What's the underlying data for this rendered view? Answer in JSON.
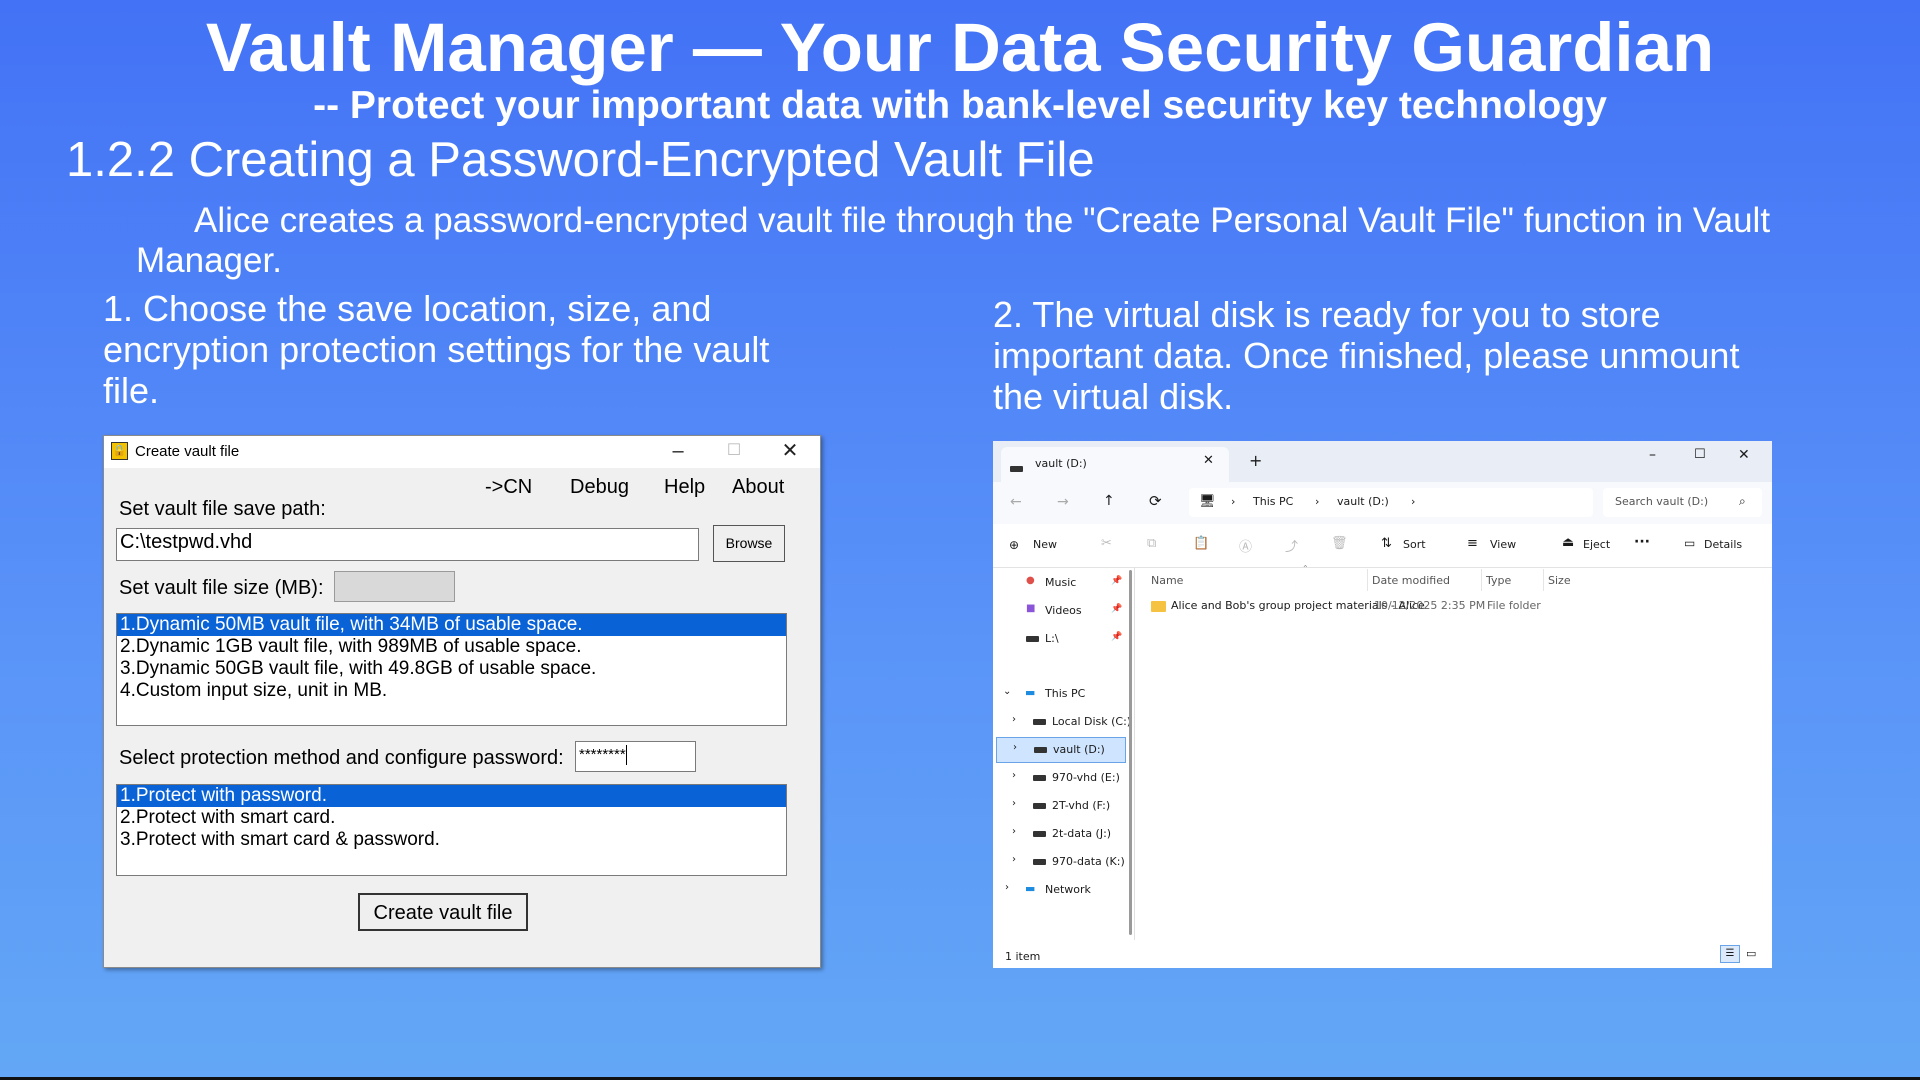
{
  "slide": {
    "title": "Vault Manager —  Your Data Security Guardian",
    "subtitle": "-- Protect your important data with bank-level security key technology",
    "section": "1.2.2 Creating a Password-Encrypted Vault File",
    "intro": "Alice creates a password-encrypted vault file through the \"Create Personal Vault File\" function in Vault Manager.",
    "step1": "1. Choose the save location, size, and encryption protection settings for the vault file.",
    "step2": "2. The virtual disk is ready for you to store important data. Once finished, please unmount the virtual disk."
  },
  "dialog": {
    "title": "Create vault file",
    "menu": [
      "->CN",
      "Debug",
      "Help",
      "About"
    ],
    "save_path_label": "Set vault file save path:",
    "save_path_value": "C:\\testpwd.vhd",
    "browse_label": "Browse",
    "size_label": "Set vault file size (MB):",
    "size_options": [
      "1.Dynamic 50MB vault file, with 34MB of usable space.",
      "2.Dynamic 1GB vault file, with 989MB of usable space.",
      "3.Dynamic 50GB vault file, with 49.8GB of usable space.",
      "4.Custom input size, unit in MB."
    ],
    "protection_label": "Select protection method and configure password:",
    "password_value": "********",
    "protection_options": [
      "1.Protect with password.",
      "2.Protect with smart card.",
      "3.Protect with smart card & password."
    ],
    "create_label": "Create vault file"
  },
  "explorer": {
    "tab_title": "vault (D:)",
    "breadcrumb": [
      "This PC",
      "vault (D:)"
    ],
    "search_placeholder": "Search vault (D:)",
    "toolbar": {
      "new": "New",
      "sort": "Sort",
      "view": "View",
      "eject": "Eject",
      "more": "···",
      "details": "Details"
    },
    "quick_access": [
      "Music",
      "Videos",
      "L:\\"
    ],
    "this_pc": "This PC",
    "drives": [
      "Local Disk (C:)",
      "vault (D:)",
      "970-vhd (E:)",
      "2T-vhd (F:)",
      "2t-data (J:)",
      "970-data (K:)"
    ],
    "network": "Network",
    "columns": [
      "Name",
      "Date modified",
      "Type",
      "Size"
    ],
    "rows": [
      {
        "name": "Alice and Bob's group project materials - Alice",
        "date": "10/12/2025 2:35 PM",
        "type": "File folder",
        "size": ""
      }
    ],
    "status": "1 item"
  }
}
